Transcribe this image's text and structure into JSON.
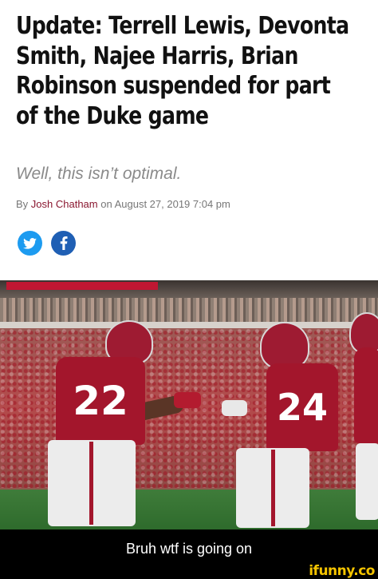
{
  "article": {
    "headline_lines": [
      "Update: Terrell Lewis, Devonta",
      "Smith, Najee Harris, Brian",
      "Robinson suspended for part",
      "of the Duke game"
    ],
    "subhead": "Well, this isn’t optimal.",
    "byline": {
      "prefix": "By ",
      "author": "Josh Chatham",
      "middle": " on ",
      "date": "August 27, 2019 7:04 pm"
    },
    "share": [
      {
        "network": "twitter",
        "icon": "twitter-bird-icon",
        "color": "#1d9bf0"
      },
      {
        "network": "facebook",
        "icon": "facebook-f-icon",
        "color": "#1f5fb4"
      }
    ]
  },
  "photo": {
    "jersey_numbers": [
      "22",
      "24"
    ],
    "team_color": "#a3162c"
  },
  "caption": "Bruh wtf is going on",
  "watermark": "ifunny.co"
}
